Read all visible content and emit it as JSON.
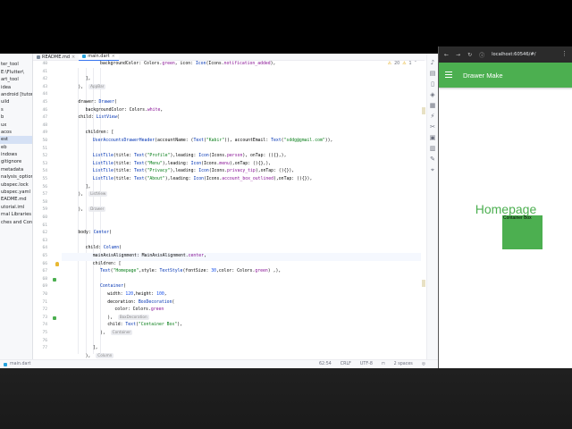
{
  "project_panel": {
    "items": [
      {
        "label": "",
        "selected": false
      },
      {
        "label": "ter_tool",
        "selected": false
      },
      {
        "label": "E:\\Flutter\\",
        "selected": false
      },
      {
        "label": "art_tool",
        "selected": false
      },
      {
        "label": "idea",
        "selected": false
      },
      {
        "label": "android [tutorial",
        "selected": false
      },
      {
        "label": "uild",
        "selected": false
      },
      {
        "label": "s",
        "selected": false
      },
      {
        "label": "b",
        "selected": false
      },
      {
        "label": "ux",
        "selected": false
      },
      {
        "label": "acos",
        "selected": false
      },
      {
        "label": "est",
        "selected": true
      },
      {
        "label": "eb",
        "selected": false
      },
      {
        "label": "indows",
        "selected": false
      },
      {
        "label": "gitignore",
        "selected": false
      },
      {
        "label": "metadata",
        "selected": false
      },
      {
        "label": "nalysis_options",
        "selected": false
      },
      {
        "label": "ubspec.lock",
        "selected": false
      },
      {
        "label": "ubspec.yaml",
        "selected": false
      },
      {
        "label": "EADME.md",
        "selected": false
      },
      {
        "label": "utorial.iml",
        "selected": false
      },
      {
        "label": "rnal Libraries",
        "selected": false
      },
      {
        "label": "ches and Con",
        "selected": false
      }
    ]
  },
  "editor": {
    "tabs": [
      {
        "label": "README.md",
        "active": false
      },
      {
        "label": "main.dart",
        "active": true
      }
    ],
    "inspections": {
      "warnings": "20",
      "infos": "1"
    },
    "gutter_line_numbers": [
      "40",
      "41",
      "42",
      "43",
      "44",
      "45",
      "46",
      "47",
      "48",
      "49",
      "50",
      "51",
      "52",
      "53",
      "54",
      "55",
      "56",
      "57",
      "58",
      "59",
      "60",
      "61",
      "62",
      "63",
      "64",
      "65",
      "66",
      "67",
      "68",
      "69",
      "70",
      "71",
      "72",
      "73",
      "74",
      "75",
      "76",
      "77"
    ],
    "lines": [
      {
        "indent": 5,
        "parts": [
          {
            "t": "backgroundColor: Colors.",
            "c": ""
          },
          {
            "t": "green",
            "c": "cd-field"
          },
          {
            "t": ", icon: ",
            "c": ""
          },
          {
            "t": "Icon",
            "c": "cd-cls"
          },
          {
            "t": "(Icons.",
            "c": ""
          },
          {
            "t": "notification_added",
            "c": "cd-field"
          },
          {
            "t": "),",
            "c": ""
          }
        ]
      },
      {
        "indent": 4,
        "parts": []
      },
      {
        "indent": 3,
        "parts": [
          {
            "t": "],",
            "c": ""
          }
        ]
      },
      {
        "indent": 2,
        "parts": [
          {
            "t": "), ",
            "c": ""
          }
        ],
        "hint": "AppBar"
      },
      {
        "indent": 0,
        "parts": []
      },
      {
        "indent": 2,
        "parts": [
          {
            "t": "drawer: ",
            "c": ""
          },
          {
            "t": "Drawer",
            "c": "cd-cls"
          },
          {
            "t": "(",
            "c": ""
          }
        ]
      },
      {
        "indent": 3,
        "parts": [
          {
            "t": "backgroundColor: Colors.",
            "c": ""
          },
          {
            "t": "white",
            "c": "cd-field"
          },
          {
            "t": ",",
            "c": ""
          }
        ]
      },
      {
        "indent": 2,
        "parts": [
          {
            "t": "child: ",
            "c": ""
          },
          {
            "t": "ListView",
            "c": "cd-cls"
          },
          {
            "t": "(",
            "c": ""
          }
        ]
      },
      {
        "indent": 0,
        "parts": []
      },
      {
        "indent": 3,
        "parts": [
          {
            "t": "children: [",
            "c": ""
          }
        ]
      },
      {
        "indent": 4,
        "parts": [
          {
            "t": "UserAccountsDrawerHeader",
            "c": "cd-cls"
          },
          {
            "t": "(accountName: (",
            "c": ""
          },
          {
            "t": "Text",
            "c": "cd-cls"
          },
          {
            "t": "(",
            "c": ""
          },
          {
            "t": "\"Kabir\"",
            "c": "cd-str"
          },
          {
            "t": ")), accountEmail: ",
            "c": ""
          },
          {
            "t": "Text",
            "c": "cd-cls"
          },
          {
            "t": "(",
            "c": ""
          },
          {
            "t": "\"sddg@gmail.com\"",
            "c": "cd-str"
          },
          {
            "t": ")),",
            "c": ""
          }
        ]
      },
      {
        "indent": 0,
        "parts": []
      },
      {
        "indent": 4,
        "parts": [
          {
            "t": "ListTile",
            "c": "cd-cls"
          },
          {
            "t": "(title: ",
            "c": ""
          },
          {
            "t": "Text",
            "c": "cd-cls"
          },
          {
            "t": "(",
            "c": ""
          },
          {
            "t": "\"Profile\"",
            "c": "cd-str"
          },
          {
            "t": "),leading: ",
            "c": ""
          },
          {
            "t": "Icon",
            "c": "cd-cls"
          },
          {
            "t": "(Icons.",
            "c": ""
          },
          {
            "t": "person",
            "c": "cd-field"
          },
          {
            "t": "), onTap: (){},),",
            "c": ""
          }
        ]
      },
      {
        "indent": 4,
        "parts": [
          {
            "t": "ListTile",
            "c": "cd-cls"
          },
          {
            "t": "(title: ",
            "c": ""
          },
          {
            "t": "Text",
            "c": "cd-cls"
          },
          {
            "t": "(",
            "c": ""
          },
          {
            "t": "\"Menu\"",
            "c": "cd-str"
          },
          {
            "t": "),leading: ",
            "c": ""
          },
          {
            "t": "Icon",
            "c": "cd-cls"
          },
          {
            "t": "(Icons.",
            "c": ""
          },
          {
            "t": "menu",
            "c": "cd-field"
          },
          {
            "t": "),onTap: (){},),",
            "c": ""
          }
        ]
      },
      {
        "indent": 4,
        "parts": [
          {
            "t": "ListTile",
            "c": "cd-cls"
          },
          {
            "t": "(title: ",
            "c": ""
          },
          {
            "t": "Text",
            "c": "cd-cls"
          },
          {
            "t": "(",
            "c": ""
          },
          {
            "t": "\"Privacy\"",
            "c": "cd-str"
          },
          {
            "t": "),leading: ",
            "c": ""
          },
          {
            "t": "Icon",
            "c": "cd-cls"
          },
          {
            "t": "(Icons.",
            "c": ""
          },
          {
            "t": "privacy_tip",
            "c": "cd-field"
          },
          {
            "t": "),onTap: (){}),",
            "c": ""
          }
        ]
      },
      {
        "indent": 4,
        "parts": [
          {
            "t": "ListTile",
            "c": "cd-cls"
          },
          {
            "t": "(title: ",
            "c": ""
          },
          {
            "t": "Text",
            "c": "cd-cls"
          },
          {
            "t": "(",
            "c": ""
          },
          {
            "t": "\"About\"",
            "c": "cd-str"
          },
          {
            "t": "),leading: ",
            "c": ""
          },
          {
            "t": "Icon",
            "c": "cd-cls"
          },
          {
            "t": "(Icons.",
            "c": ""
          },
          {
            "t": "account_box_outlined",
            "c": "cd-field"
          },
          {
            "t": "),onTap: (){}),",
            "c": ""
          }
        ]
      },
      {
        "indent": 3,
        "parts": [
          {
            "t": "],",
            "c": ""
          }
        ]
      },
      {
        "indent": 2,
        "parts": [
          {
            "t": "), ",
            "c": ""
          }
        ],
        "hint": "ListView"
      },
      {
        "indent": 0,
        "parts": []
      },
      {
        "indent": 2,
        "parts": [
          {
            "t": "), ",
            "c": ""
          }
        ],
        "hint": "Drawer"
      },
      {
        "indent": 0,
        "parts": []
      },
      {
        "indent": 0,
        "parts": []
      },
      {
        "indent": 2,
        "parts": [
          {
            "t": "body: ",
            "c": ""
          },
          {
            "t": "Center",
            "c": "cd-cls"
          },
          {
            "t": "(",
            "c": ""
          }
        ]
      },
      {
        "indent": 0,
        "parts": []
      },
      {
        "indent": 3,
        "parts": [
          {
            "t": "child: ",
            "c": ""
          },
          {
            "t": "Column",
            "c": "cd-cls"
          },
          {
            "t": "(",
            "c": ""
          }
        ]
      },
      {
        "indent": 4,
        "parts": [
          {
            "t": "mainAxisAlignment: MainAxisAlignment.",
            "c": ""
          },
          {
            "t": "center",
            "c": "cd-field"
          },
          {
            "t": ",",
            "c": ""
          }
        ],
        "current": true
      },
      {
        "indent": 4,
        "parts": [
          {
            "t": "children: [",
            "c": ""
          }
        ]
      },
      {
        "indent": 5,
        "parts": [
          {
            "t": "Text",
            "c": "cd-cls"
          },
          {
            "t": "(",
            "c": ""
          },
          {
            "t": "\"Homepage\"",
            "c": "cd-str"
          },
          {
            "t": ",style: ",
            "c": ""
          },
          {
            "t": "TextStyle",
            "c": "cd-cls"
          },
          {
            "t": "(fontSize: ",
            "c": ""
          },
          {
            "t": "30",
            "c": "cd-num"
          },
          {
            "t": ",color: Colors.",
            "c": ""
          },
          {
            "t": "green",
            "c": "cd-field"
          },
          {
            "t": ") ,),",
            "c": ""
          }
        ]
      },
      {
        "indent": 0,
        "parts": []
      },
      {
        "indent": 5,
        "parts": [
          {
            "t": "Container",
            "c": "cd-cls"
          },
          {
            "t": "(",
            "c": ""
          }
        ]
      },
      {
        "indent": 6,
        "parts": [
          {
            "t": "width: ",
            "c": ""
          },
          {
            "t": "120",
            "c": "cd-num"
          },
          {
            "t": ",height: ",
            "c": ""
          },
          {
            "t": "100",
            "c": "cd-num"
          },
          {
            "t": ",",
            "c": ""
          }
        ]
      },
      {
        "indent": 6,
        "parts": [
          {
            "t": "decoration: ",
            "c": ""
          },
          {
            "t": "BoxDecoration",
            "c": "cd-cls"
          },
          {
            "t": "(",
            "c": ""
          }
        ]
      },
      {
        "indent": 7,
        "parts": [
          {
            "t": "color: Colors.",
            "c": ""
          },
          {
            "t": "green",
            "c": "cd-field"
          }
        ]
      },
      {
        "indent": 6,
        "parts": [
          {
            "t": "), ",
            "c": ""
          }
        ],
        "hint": "BoxDecoration"
      },
      {
        "indent": 6,
        "parts": [
          {
            "t": "child: ",
            "c": ""
          },
          {
            "t": "Text",
            "c": "cd-cls"
          },
          {
            "t": "(",
            "c": ""
          },
          {
            "t": "\"Container Box\"",
            "c": "cd-str"
          },
          {
            "t": "),",
            "c": ""
          }
        ]
      },
      {
        "indent": 5,
        "parts": [
          {
            "t": "), ",
            "c": ""
          }
        ],
        "hint": "Container"
      },
      {
        "indent": 0,
        "parts": []
      },
      {
        "indent": 4,
        "parts": [
          {
            "t": "],",
            "c": ""
          }
        ]
      },
      {
        "indent": 3,
        "parts": [
          {
            "t": "), ",
            "c": ""
          }
        ],
        "hint": "Column"
      }
    ]
  },
  "status_bar": {
    "file": "main.dart",
    "position": "62:54",
    "line_ending": "CRLF",
    "encoding": "UTF-8",
    "indent": "2 spaces"
  },
  "browser": {
    "url": "localhost:60546/#/"
  },
  "app": {
    "title": "Drawer Make",
    "homepage_text": "Homepage",
    "container_label": "Container Box",
    "colors": {
      "primary": "#4caf50"
    }
  }
}
